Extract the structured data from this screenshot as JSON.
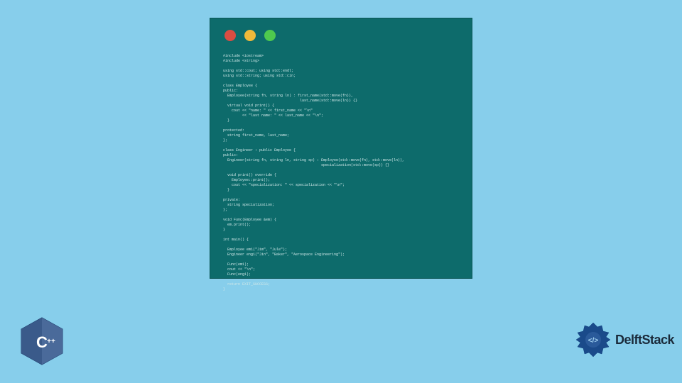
{
  "code_window": {
    "dot_colors": {
      "red": "#d94d42",
      "yellow": "#f0b93a",
      "green": "#4ec94e"
    },
    "code_lines": [
      "#include <iostream>",
      "#include <string>",
      "",
      "using std::cout; using std::endl;",
      "using std::string; using std::cin;",
      "",
      "class Employee {",
      "public:",
      "  Employee(string fn, string ln) : first_name(std::move(fn)),",
      "                                    last_name(std::move(ln)) {}",
      "  virtual void print() {",
      "    cout << \"name: \" << first_name << \"\\n\"",
      "         << \"last name: \" << last_name << \"\\n\";",
      "  }",
      "",
      "protected:",
      "  string first_name, last_name;",
      "};",
      "",
      "class Engineer : public Employee {",
      "public:",
      "  Engineer(string fn, string ln, string sp) : Employee(std::move(fn), std::move(ln)),",
      "                                              specialization(std::move(sp)) {}",
      "",
      "  void print() override {",
      "    Employee::print();",
      "    cout << \"specialization: \" << specialization << \"\\n\";",
      "  }",
      "",
      "private:",
      "  string specialization;",
      "};",
      "",
      "void Func(Employee &em) {",
      "  em.print();",
      "}",
      "",
      "int main() {",
      "",
      "  Employee em1(\"Jim\", \"Jule\");",
      "  Engineer eng1(\"Jin\", \"Baker\", \"Aerospace Engineering\");",
      "",
      "  Func(em1);",
      "  cout << \"\\n\";",
      "  Func(eng1);",
      "",
      "  return EXIT_SUCCESS;",
      "}"
    ]
  },
  "logos": {
    "cpp_label": "C++",
    "delft_label": "DelftStack"
  }
}
